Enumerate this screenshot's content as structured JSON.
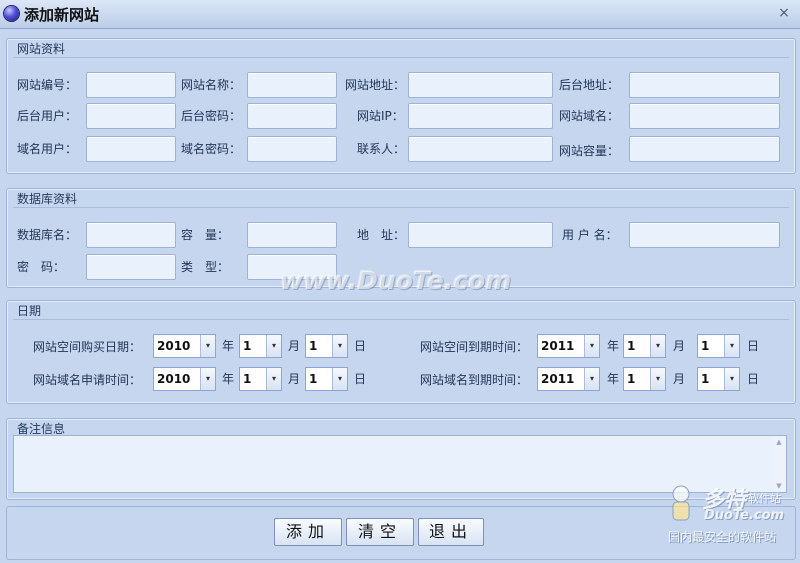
{
  "window": {
    "title": "添加新网站",
    "close_glyph": "×"
  },
  "site_info": {
    "title": "网站资料",
    "labels": {
      "site_no": "网站编号：",
      "site_name": "网站名称：",
      "site_url": "网站地址：",
      "admin_url": "后台地址：",
      "admin_user": "后台用户：",
      "admin_pass": "后台密码：",
      "site_ip": "网站IP：",
      "site_domain": "网站域名：",
      "domain_user": "域名用户：",
      "domain_pass": "域名密码：",
      "contact": "联系人：",
      "site_capacity": "网站容量："
    }
  },
  "db_info": {
    "title": "数据库资料",
    "labels": {
      "db_name": "数据库名：",
      "capacity": "容　量：",
      "address": "地　址：",
      "username": "用 户 名：",
      "password": "密　码：",
      "type": "类　型："
    }
  },
  "dates": {
    "title": "日期",
    "units": {
      "year": "年",
      "month": "月",
      "day": "日"
    },
    "space_purchase": {
      "label": "网站空间购买日期：",
      "year": "2010",
      "month": "1",
      "day": "1"
    },
    "space_expiry": {
      "label": "网站空间到期时间：",
      "year": "2011",
      "month": "1",
      "day": "1"
    },
    "domain_apply": {
      "label": "网站域名申请时间：",
      "year": "2010",
      "month": "1",
      "day": "1"
    },
    "domain_expiry": {
      "label": "网站域名到期时间：",
      "year": "2011",
      "month": "1",
      "day": "1"
    }
  },
  "notes": {
    "title": "备注信息"
  },
  "buttons": {
    "add": "添加",
    "clear": "清空",
    "exit": "退出"
  },
  "watermark": {
    "text": "www.DuoTe.com"
  },
  "brand": {
    "cn": "多特",
    "small": "软件站",
    "en": "DuoTe.com",
    "slogan": "国内最安全的软件站"
  },
  "icons": {
    "app": "app-orb-icon",
    "close": "close-icon",
    "dropdown": "chevron-down-icon"
  }
}
